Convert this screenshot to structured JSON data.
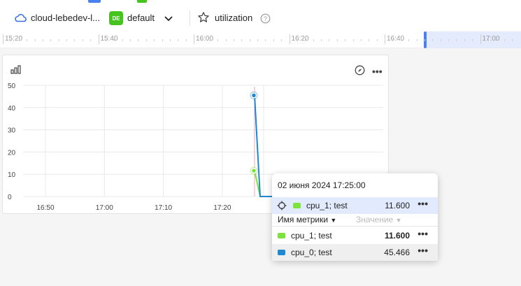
{
  "header": {
    "cloud_label": "cloud-lebedev-l...",
    "folder_badge": "DE",
    "folder_label": "default",
    "dashboard_title": "utilization"
  },
  "timeline": {
    "labels": [
      "15:20",
      "15:40",
      "16:00",
      "16:20",
      "16:40",
      "17:00"
    ]
  },
  "chart_data": {
    "type": "line",
    "x": [
      "17:24",
      "17:25",
      "17:26",
      "17:27",
      "17:28",
      "17:29",
      "17:30"
    ],
    "series": [
      {
        "name": "cpu_1; test",
        "color": "#7ce33c",
        "values": [
          null,
          11.6,
          0,
          0,
          0,
          0,
          0
        ]
      },
      {
        "name": "cpu_0; test",
        "color": "#1e88d2",
        "values": [
          null,
          45.466,
          0,
          0,
          0,
          0,
          0
        ]
      }
    ],
    "xticks": [
      "16:50",
      "17:00",
      "17:10",
      "17:20"
    ],
    "yticks": [
      "0",
      "10",
      "20",
      "30",
      "40",
      "50"
    ],
    "ylim": [
      0,
      50
    ],
    "xlim_minutes": [
      -40,
      8
    ],
    "grid": true
  },
  "tooltip": {
    "date": "02 июня 2024 17:25:00",
    "highlight": {
      "name": "cpu_1; test",
      "value": "11.600",
      "color": "#7ce33c"
    },
    "col_name": "Имя метрики",
    "col_value": "Значение",
    "rows": [
      {
        "name": "cpu_1; test",
        "value": "11.600",
        "color": "#7ce33c"
      },
      {
        "name": "cpu_0; test",
        "value": "45.466",
        "color": "#1e88d2"
      }
    ]
  }
}
